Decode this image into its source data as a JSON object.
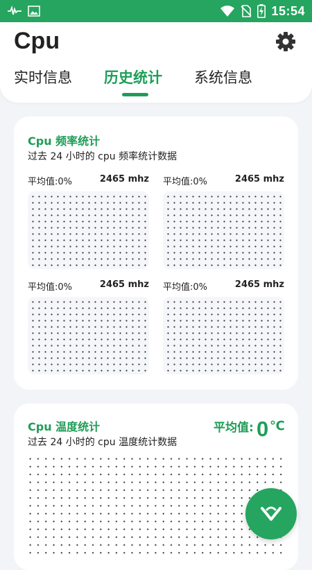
{
  "status_bar": {
    "time": "15:54",
    "icons": [
      "activity-icon",
      "image-icon",
      "wifi-icon",
      "no-sim-icon",
      "battery-charging-icon"
    ]
  },
  "app": {
    "title": "Cpu",
    "settings_icon": "gear-icon"
  },
  "tabs": [
    {
      "label": "实时信息",
      "active": false
    },
    {
      "label": "历史统计",
      "active": true
    },
    {
      "label": "系统信息",
      "active": false
    }
  ],
  "freq_card": {
    "title": "Cpu 频率统计",
    "subtitle": "过去 24 小时的 cpu 频率统计数据",
    "panels": [
      {
        "avg_label": "平均值:0%",
        "freq": "2465 mhz"
      },
      {
        "avg_label": "平均值:0%",
        "freq": "2465 mhz"
      },
      {
        "avg_label": "平均值:0%",
        "freq": "2465 mhz"
      },
      {
        "avg_label": "平均值:0%",
        "freq": "2465 mhz"
      }
    ]
  },
  "temp_card": {
    "title": "Cpu 温度统计",
    "subtitle": "过去 24 小时的 cpu 温度统计数据",
    "avg_label": "平均值:",
    "avg_value": "0",
    "avg_unit": "℃"
  },
  "fab": {
    "icon": "chevron-down-heart-icon"
  },
  "colors": {
    "accent": "#1f9d57",
    "status_bar": "#25a55f",
    "background": "#f3f4f8"
  }
}
